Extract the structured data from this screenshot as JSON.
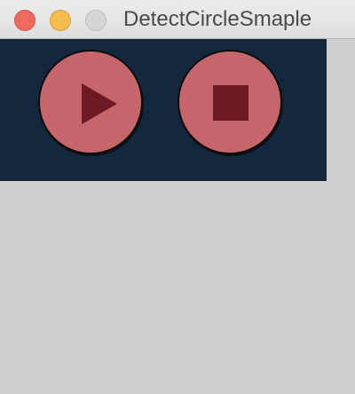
{
  "window": {
    "title": "DetectCircleSmaple"
  },
  "controls": {
    "play_icon": "play-triangle",
    "stop_icon": "stop-square"
  },
  "colors": {
    "canvas_background": "#14283d",
    "button_fill": "#c6666a",
    "glyph_fill": "#6e1a24",
    "close_button": "#ee6a5e",
    "minimize_button": "#f5bd4f",
    "zoom_button": "#d6d6d6"
  }
}
